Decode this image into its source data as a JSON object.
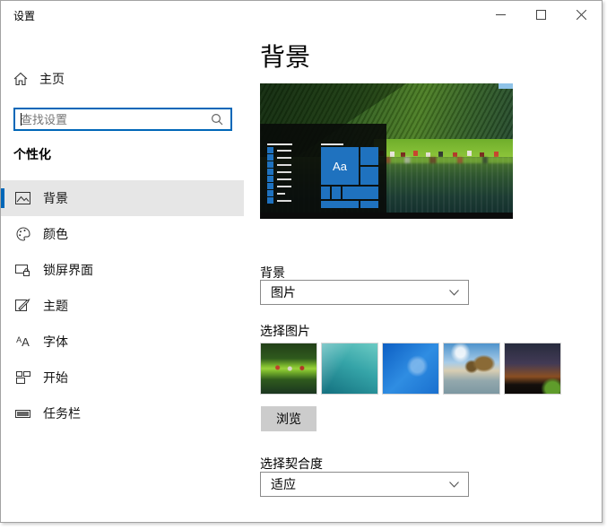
{
  "window": {
    "title": "设置",
    "controls": {
      "minimize": "minimize",
      "maximize": "maximize",
      "close": "close"
    }
  },
  "sidebar": {
    "home_label": "主页",
    "search": {
      "placeholder": "查找设置"
    },
    "section_header": "个性化",
    "items": [
      {
        "label": "背景",
        "icon": "background-icon",
        "selected": true
      },
      {
        "label": "颜色",
        "icon": "colors-icon",
        "selected": false
      },
      {
        "label": "锁屏界面",
        "icon": "lock-screen-icon",
        "selected": false
      },
      {
        "label": "主题",
        "icon": "themes-icon",
        "selected": false
      },
      {
        "label": "字体",
        "icon": "fonts-icon",
        "selected": false
      },
      {
        "label": "开始",
        "icon": "start-icon",
        "selected": false
      },
      {
        "label": "任务栏",
        "icon": "taskbar-icon",
        "selected": false
      }
    ]
  },
  "main": {
    "page_title": "背景",
    "preview": {
      "tile_label": "Aa",
      "description": "wallpaper-preview-with-start-menu"
    },
    "background_section": {
      "label": "背景",
      "selected_value": "图片"
    },
    "picture_section": {
      "label": "选择图片",
      "browse_label": "浏览",
      "thumbnails": [
        "mountain-village",
        "underwater",
        "windows-default-blue",
        "beach-rocks",
        "night-sky"
      ]
    },
    "fit_section": {
      "label": "选择契合度",
      "selected_value": "适应"
    }
  },
  "colors": {
    "accent_blue": "#0067b8",
    "selected_row_gray": "#e6e6e6",
    "tile_blue": "#1f72bf",
    "browse_button_gray": "#cccccc"
  }
}
